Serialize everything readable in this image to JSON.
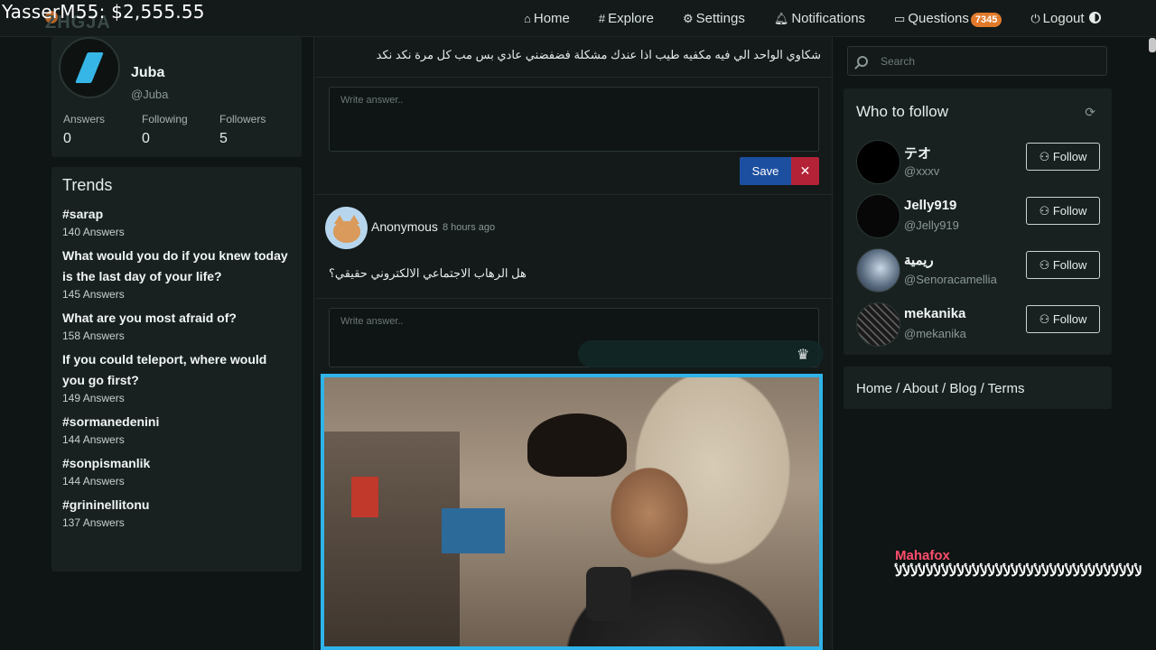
{
  "overlay": {
    "donation": "YasserM55: $2,555.55"
  },
  "brand": {
    "logo": "ZHGJA"
  },
  "nav": {
    "home": "Home",
    "explore": "Explore",
    "settings": "Settings",
    "notifications": "Notifications",
    "questions": "Questions",
    "questions_count": "7345",
    "logout": "Logout"
  },
  "profile": {
    "name": "Juba",
    "handle": "@Juba",
    "answers_label": "Answers",
    "answers": "0",
    "following_label": "Following",
    "following": "0",
    "followers_label": "Followers",
    "followers": "5"
  },
  "trends": {
    "title": "Trends",
    "items": [
      {
        "topic": "#sarap",
        "count": "140 Answers"
      },
      {
        "topic": "What would you do if you knew today is the last day of your life?",
        "count": "145 Answers"
      },
      {
        "topic": "What are you most afraid of?",
        "count": "158 Answers"
      },
      {
        "topic": "If you could teleport, where would you go first?",
        "count": "149 Answers"
      },
      {
        "topic": "#sormanedenini",
        "count": "144 Answers"
      },
      {
        "topic": "#sonpismanlik",
        "count": "144 Answers"
      },
      {
        "topic": "#grininellitonu",
        "count": "137 Answers"
      }
    ]
  },
  "feed": {
    "question1_tail": "شكاوي الواحد الي فيه مكفيه طيب اذا عندك مشكلة فضفضني عادي بس مب كل مرة نكد نكد",
    "answer_placeholder": "Write answer..",
    "save": "Save",
    "cancel": "✕",
    "post2": {
      "author": "Anonymous",
      "time": "8 hours ago",
      "question": "هل الرهاب الاجتماعي الالكتروني حقيقي؟"
    }
  },
  "search": {
    "placeholder": "Search"
  },
  "who_to_follow": {
    "title": "Who to follow",
    "follow_label": "Follow",
    "users": [
      {
        "name": "テオ",
        "handle": "@xxxv"
      },
      {
        "name": "Jelly919",
        "handle": "@Jelly919"
      },
      {
        "name": "ريمية",
        "handle": "@Senoracamellia"
      },
      {
        "name": "mekanika",
        "handle": "@mekanika"
      }
    ]
  },
  "footer": {
    "links": "Home / About / Blog / Terms"
  },
  "chat": {
    "name": "Mahafox",
    "message": "ﻷﻷﻷﻷﻷﻷﻷﻷﻷﻷﻷﻷﻷﻷﻷﻷﻷﻷﻷﻷﻷﻷﻷﻷﻷﻷﻷﻷﻷﻷﻷﻷ"
  },
  "colors": {
    "accent": "#e07a2a",
    "save": "#1d4fa0",
    "cancel": "#b32237",
    "webcam_border": "#2fb3e8",
    "chat_name": "#ff4d6d"
  }
}
